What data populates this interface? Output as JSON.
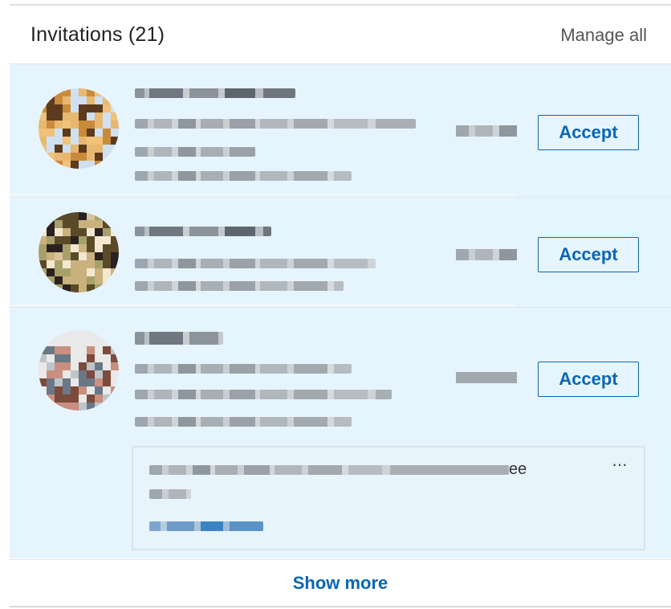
{
  "header": {
    "title": "Invitations (21)",
    "manage_label": "Manage all"
  },
  "invitations": [
    {
      "accept_label": "Accept"
    },
    {
      "accept_label": "Accept"
    },
    {
      "accept_label": "Accept",
      "message": {
        "trailing_text": "ee",
        "more_icon": "more-horizontal-icon",
        "more_label": "···"
      }
    }
  ],
  "footer": {
    "show_more_label": "Show more"
  },
  "colors": {
    "accent": "#0a66b2",
    "card_bg": "#e6f4fd"
  }
}
